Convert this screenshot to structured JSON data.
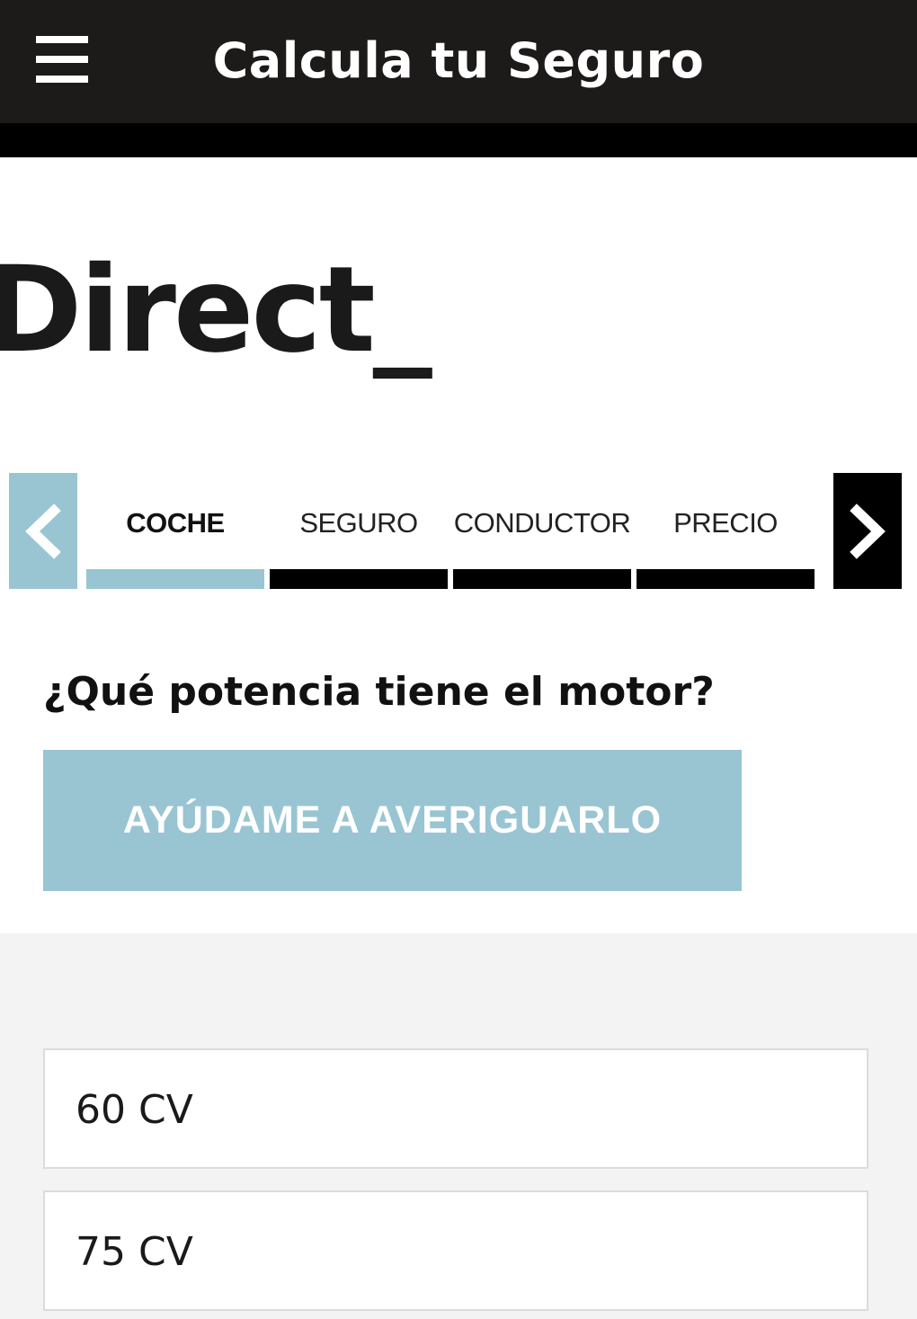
{
  "header": {
    "title": "Calcula tu Seguro",
    "menu_icon": "hamburger-menu-icon"
  },
  "brand": {
    "logo_text": "Direct_"
  },
  "stepper": {
    "prev_icon": "chevron-left-icon",
    "next_icon": "chevron-right-icon",
    "steps": [
      {
        "label": "COCHE",
        "active": true
      },
      {
        "label": "SEGURO",
        "active": false
      },
      {
        "label": "CONDUCTOR",
        "active": false
      },
      {
        "label": "PRECIO",
        "active": false
      }
    ]
  },
  "question": {
    "text": "¿Qué potencia tiene el motor?",
    "help_button_label": "AYÚDAME A AVERIGUARLO"
  },
  "options": [
    {
      "label": "60 CV"
    },
    {
      "label": "75 CV"
    }
  ],
  "colors": {
    "header_bg": "#1d1b1a",
    "accent": "#99c5d3",
    "inactive_bar": "#000000",
    "options_bg": "#f3f3f3"
  }
}
